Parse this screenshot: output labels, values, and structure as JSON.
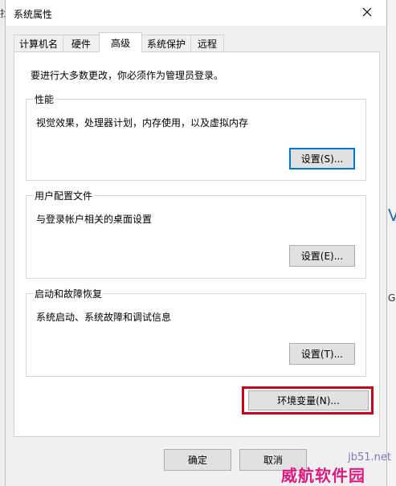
{
  "window": {
    "title": "系统属性",
    "close_icon": "close-icon"
  },
  "tabs": [
    {
      "label": "计算机名"
    },
    {
      "label": "硬件"
    },
    {
      "label": "高级",
      "active": true
    },
    {
      "label": "系统保护"
    },
    {
      "label": "远程"
    }
  ],
  "advanced": {
    "admin_note": "要进行大多数更改，你必须作为管理员登录。",
    "performance": {
      "title": "性能",
      "description": "视觉效果，处理器计划，内存使用，以及虚拟内存",
      "button": "设置(S)..."
    },
    "user_profiles": {
      "title": "用户配置文件",
      "description": "与登录帐户相关的桌面设置",
      "button": "设置(E)..."
    },
    "startup_recovery": {
      "title": "启动和故障恢复",
      "description": "系统启动、系统故障和调试信息",
      "button": "设置(T)..."
    },
    "env_button": "环境变量(N)..."
  },
  "footer": {
    "ok": "确定",
    "cancel": "取消"
  },
  "background": {
    "left_glyph": "找",
    "right_glyph_1": "V",
    "right_glyph_2": "G"
  },
  "watermark": {
    "site": "jb51.net",
    "name": "威航软件园"
  },
  "colors": {
    "highlight_border": "#d0021b",
    "focus_border": "#0078d7",
    "watermark_text": "#e0197d"
  }
}
